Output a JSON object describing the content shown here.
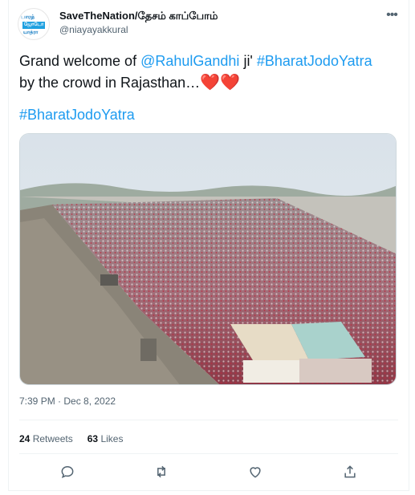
{
  "tweet": {
    "display_name": "SaveTheNation/தேசம் காப்போம்",
    "handle": "@niayayakkural",
    "avatar_text": [
      "பாரத்",
      "ஜோடோ",
      "யாத்ரா"
    ],
    "text_part1": "Grand welcome of ",
    "mention": "@RahulGandhi",
    "text_part2": " ji' ",
    "hashtag_inline": "#BharatJodoYatra",
    "text_part3": "by the crowd in Rajasthan…",
    "hearts": "❤️❤️",
    "hashtag_line": "#BharatJodoYatra",
    "timestamp": "7:39 PM · Dec 8, 2022",
    "retweets_count": "24",
    "retweets_label": "Retweets",
    "likes_count": "63",
    "likes_label": "Likes"
  },
  "actions": {
    "reply": "reply-icon",
    "retweet": "retweet-icon",
    "like": "heart-icon",
    "share": "share-icon"
  },
  "colors": {
    "link": "#1d9bf0",
    "secondary_text": "#536471",
    "primary_text": "#0f1419"
  }
}
